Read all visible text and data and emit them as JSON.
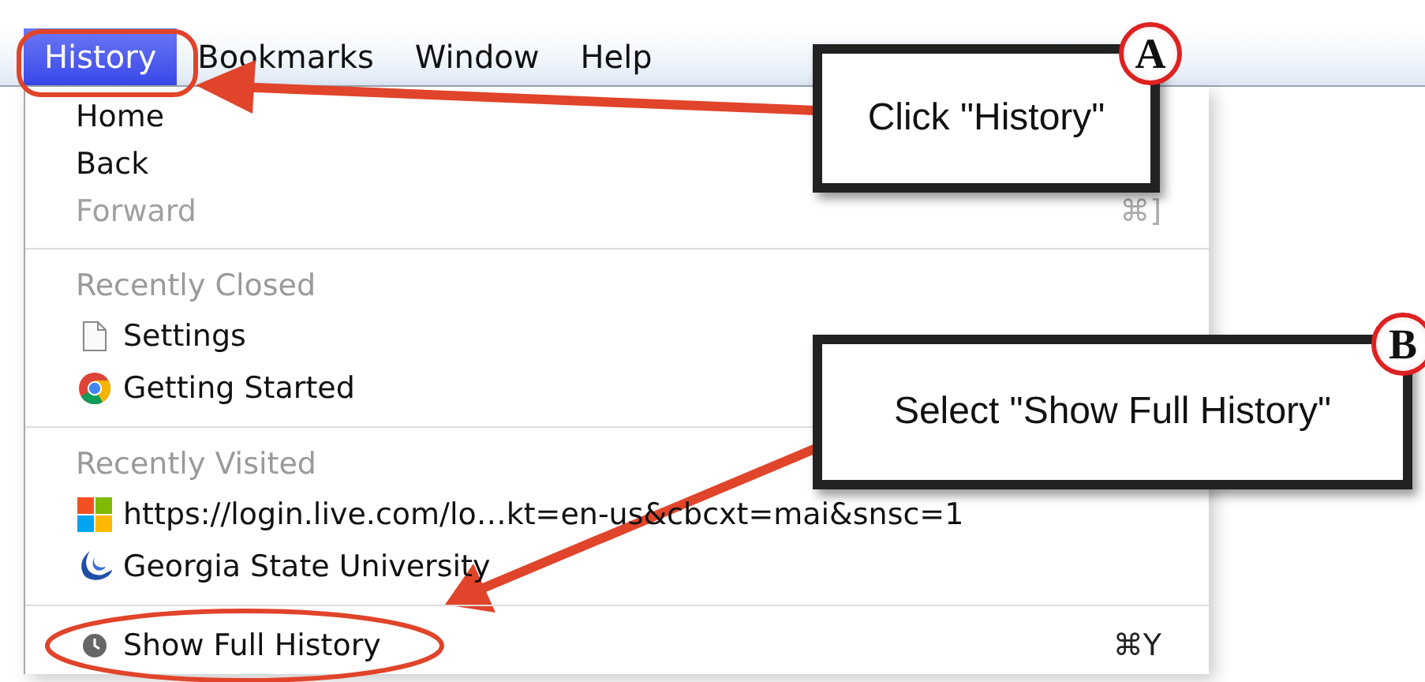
{
  "menu_bar": [
    {
      "label": "History",
      "selected": true
    },
    {
      "label": "Bookmarks",
      "selected": false
    },
    {
      "label": "Window",
      "selected": false
    },
    {
      "label": "Help",
      "selected": false
    }
  ],
  "menu": {
    "items": [
      {
        "kind": "item",
        "label": "Home",
        "disabled": false
      },
      {
        "kind": "item",
        "label": "Back",
        "disabled": false
      },
      {
        "kind": "item",
        "label": "Forward",
        "disabled": true,
        "shortcut": "⌘]"
      },
      {
        "kind": "separator"
      },
      {
        "kind": "header",
        "label": "Recently Closed"
      },
      {
        "kind": "item",
        "label": "Settings",
        "disabled": false
      },
      {
        "kind": "item",
        "label": "Getting Started",
        "disabled": false
      },
      {
        "kind": "separator"
      },
      {
        "kind": "header",
        "label": "Recently Visited"
      },
      {
        "kind": "item",
        "label": "https://login.live.com/lo…kt=en-us&cbcxt=mai&snsc=1",
        "disabled": false
      },
      {
        "kind": "item",
        "label": "Georgia State University",
        "disabled": false
      },
      {
        "kind": "separator"
      },
      {
        "kind": "item",
        "label": "Show Full History",
        "disabled": false,
        "shortcut": "⌘Y"
      }
    ]
  },
  "annotations": [
    {
      "badge": "A",
      "text": "Click \"History\""
    },
    {
      "badge": "B",
      "text": "Select \"Show Full History\""
    }
  ]
}
